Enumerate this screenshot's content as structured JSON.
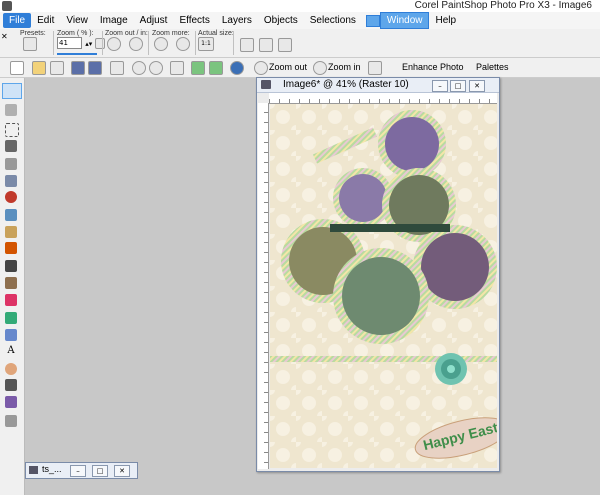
{
  "app": {
    "title": "Corel PaintShop Photo Pro X3 - Image6"
  },
  "menu": [
    "File",
    "Edit",
    "View",
    "Image",
    "Adjust",
    "Effects",
    "Layers",
    "Objects",
    "Selections",
    "Window",
    "Help"
  ],
  "options": {
    "presets_label": "Presets:",
    "zoom_label": "Zoom ( % ):",
    "zoom_value": "41",
    "zoom_out_in_label": "Zoom out / in:",
    "zoom_more_label": "Zoom more:",
    "actual_size_label": "Actual size:",
    "actual_size_value": "1:1"
  },
  "toolbar": {
    "zoom_out": "Zoom out",
    "zoom_in": "Zoom in",
    "enhance_photo": "Enhance Photo",
    "palettes": "Palettes"
  },
  "image_window": {
    "title": "Image6* @  41% (Raster 10)",
    "greeting": "Happy Easter!"
  },
  "minimized_window": {
    "title": "ts_..."
  },
  "colors": {
    "accent": "#2f7ed8",
    "canvas_bg": "#efe6cf"
  }
}
